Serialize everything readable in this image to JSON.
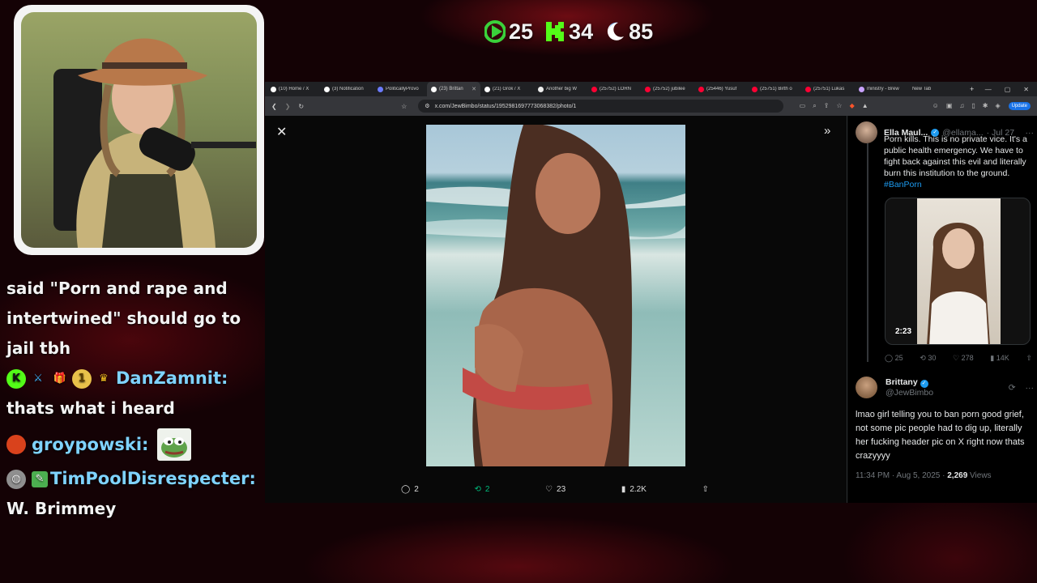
{
  "stream": {
    "stats": [
      {
        "icon": "play-icon",
        "value": "25",
        "color": "#3ad13a"
      },
      {
        "icon": "kick-icon",
        "value": "34",
        "color": "#53fc18"
      },
      {
        "icon": "moon-icon",
        "value": "85",
        "color": "#4f9cf5"
      }
    ]
  },
  "chat": {
    "first_message": "said \"Porn and rape and intertwined\" should go to jail tbh",
    "messages": [
      {
        "user": "DanZamnit:",
        "text": "thats what i heard",
        "color": "#7fd3ff"
      },
      {
        "user": "groypowski:",
        "text": "",
        "color": "#7fd3ff"
      },
      {
        "user": "TimPoolDisrespecter:",
        "text": "W. Brimmey",
        "color": "#7fd3ff"
      }
    ]
  },
  "browser": {
    "tabs": [
      {
        "label": "(10) Home / X",
        "active": false
      },
      {
        "label": "(3) Notification",
        "active": false
      },
      {
        "label": "PoliticallyProvo",
        "active": false
      },
      {
        "label": "(23) Brittan",
        "active": true
      },
      {
        "label": "(21) Grok / X",
        "active": false
      },
      {
        "label": "Another big W",
        "active": false
      },
      {
        "label": "(25752) LORN",
        "active": false
      },
      {
        "label": "(25752) jubilee",
        "active": false
      },
      {
        "label": "(25446) Yusuf",
        "active": false
      },
      {
        "label": "(25751) Birth o",
        "active": false
      },
      {
        "label": "(25751) Lukas",
        "active": false
      },
      {
        "label": "ministry - Brew",
        "active": false
      },
      {
        "label": "New Tab",
        "active": false
      }
    ],
    "url": "x.com/JewBimbo/status/1952981697773068382/photo/1",
    "update_label": "Update"
  },
  "photo_actions": {
    "replies": "2",
    "reposts": "2",
    "likes": "23",
    "views": "2.2K"
  },
  "quoted_tweet": {
    "name": "Ella Maul...",
    "handle": "@ellama...",
    "date": "· Jul 27",
    "text": "Porn kills. This is no private vice. It's a public health emergency. We have to fight back against this evil and literally burn this institution to the ground.",
    "hashtag": "#BanPorn",
    "video_duration": "2:23",
    "replies": "25",
    "reposts": "30",
    "likes": "278",
    "views": "14K"
  },
  "main_tweet": {
    "name": "Brittany",
    "handle": "@JewBimbo",
    "text": "lmao girl telling you to ban porn good grief, not some pic people had to dig up, literally her fucking header pic on X right now thats crazyyyy",
    "time": "11:34 PM · Aug 5, 2025 ·",
    "views_count": "2,269",
    "views_label": "Views"
  }
}
